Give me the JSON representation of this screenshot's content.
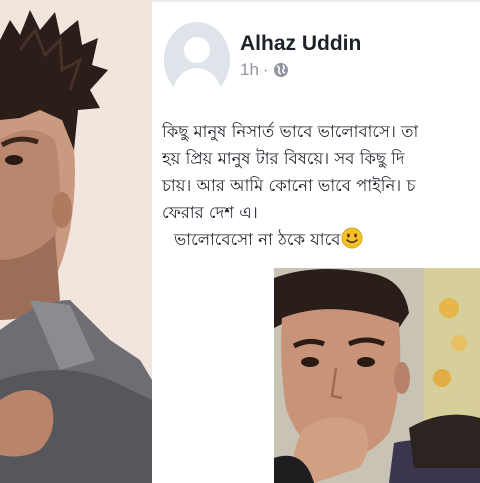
{
  "left_photo": {
    "description_icon": "profile-photo"
  },
  "post": {
    "author": "Alhaz Uddin",
    "time": "1h",
    "separator": "·",
    "privacy_icon": "globe-icon",
    "lines": [
      "কিছু মানুষ নিসার্ত ভাবে ভালোবাসে। তা",
      "হয় প্রিয় মানুষ টার বিষয়ে। সব কিছু দি",
      "চায়। আর আমি কোনো ভাবে পাইনি। চ",
      "ফেরার দেশ এ।",
      "ভালোবেসো না ঠকে যাবে"
    ],
    "emoji": "smiley-emoji"
  },
  "colors": {
    "name": "#1d2129",
    "meta": "#90949c",
    "emoji_face": "#f7c12b"
  }
}
